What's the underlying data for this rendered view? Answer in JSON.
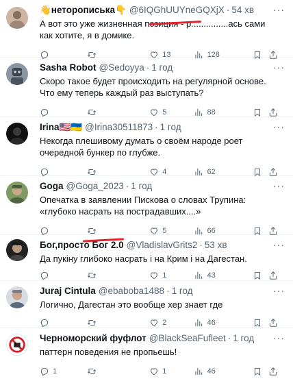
{
  "tweets": [
    {
      "name": "👋неторописька👇",
      "handle": "@6IQGhUUYneGQXjX",
      "time": "54 хв",
      "text": "А вот это уже жизненная позиция - р...............ась сами как хотите, я в домике.",
      "replies": "",
      "retweets": "",
      "likes": "13",
      "views": "128",
      "avatar_color": "#cdb4a3"
    },
    {
      "name": "Sasha Robot",
      "handle": "@Sedoyya",
      "time": "1 год",
      "text": "Скоро такое будет происходить на регулярной основе. Что ему теперь каждый раз выступать?",
      "replies": "",
      "retweets": "",
      "likes": "5",
      "views": "88",
      "avatar_color": "#5a6470"
    },
    {
      "name": "Irina🇺🇸🇺🇦",
      "handle": "@Irina30511873",
      "time": "1 год",
      "text": "Некогда плешивому думать о своём народе роет очередной бункер по глубже.",
      "replies": "",
      "retweets": "",
      "likes": "4",
      "views": "62",
      "avatar_color": "#1c1c1c"
    },
    {
      "name": "Goga",
      "handle": "@Goga_2023",
      "time": "1 год",
      "text": "Опечатка в заявлении Пискова о словах Трупина: «глубоко насрать на пострадавших....»",
      "replies": "",
      "retweets": "",
      "likes": "5",
      "views": "66",
      "avatar_color": "#6f8a55"
    },
    {
      "name": "Бог,просто Бог 2.0",
      "handle": "@VladislavGrits2",
      "time": "53 хв",
      "text": "Да пукіну глибоко насрать і на Крим і на Дагестан.",
      "replies": "",
      "retweets": "",
      "likes": "1",
      "views": "43",
      "avatar_color": "#2b2b2b"
    },
    {
      "name": "Juraj Cintula",
      "handle": "@ebaboba1488",
      "time": "1 год",
      "text": "Логично, Дагестан это вообще хер знает где",
      "replies": "",
      "retweets": "",
      "likes": "2",
      "views": "46",
      "avatar_color": "#c9ced6"
    },
    {
      "name": "Черноморский фуфлот",
      "handle": "@BlackSeaFufleet",
      "time": "1 год",
      "text": "паттерн поведения не пропьешь!",
      "replies": "1",
      "retweets": "",
      "likes": "1",
      "views": "46",
      "avatar_color": "#ffffff"
    }
  ],
  "colors": {
    "muted": "#536471",
    "redaction": "#e0242f",
    "border": "#eff3f4"
  }
}
